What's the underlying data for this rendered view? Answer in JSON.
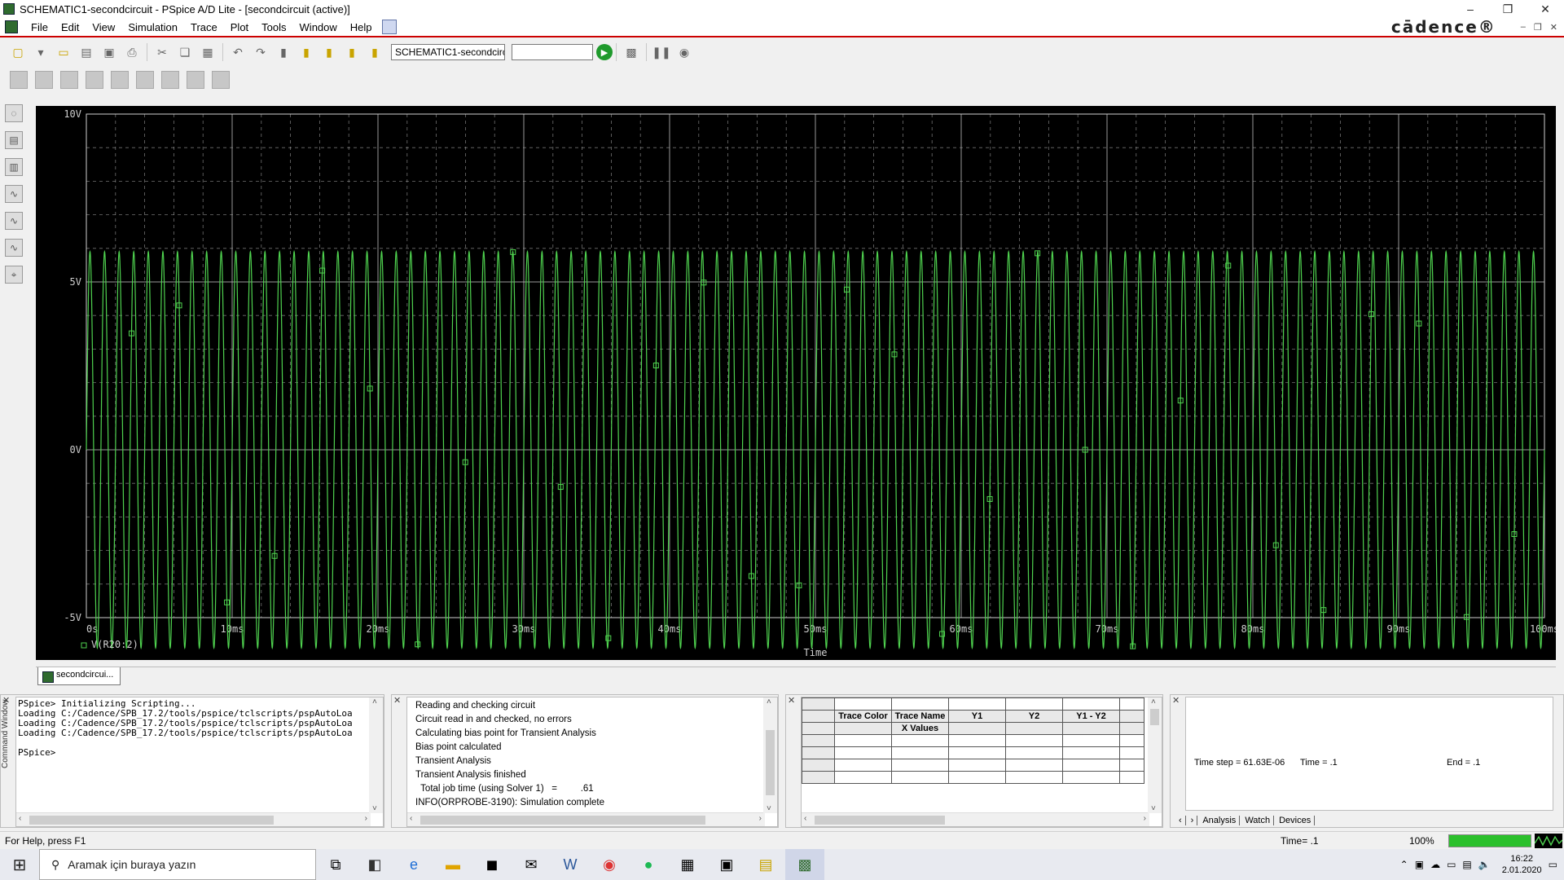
{
  "window": {
    "title": "SCHEMATIC1-secondcircuit - PSpice A/D Lite - [secondcircuit (active)]",
    "minimize": "–",
    "maximize": "❐",
    "close": "✕"
  },
  "menu": {
    "items": [
      "File",
      "Edit",
      "View",
      "Simulation",
      "Trace",
      "Plot",
      "Tools",
      "Window",
      "Help"
    ],
    "brand": "cādence®"
  },
  "toolbar": {
    "profile_value": "SCHEMATIC1-secondcircui",
    "run_icon": "play-icon"
  },
  "plot": {
    "background": "#000000",
    "trace_color": "#4fd24f",
    "grid_color": "#bdbdbd",
    "axis_color": "#cfcfcf",
    "y_tick_labels": [
      "10V",
      "5V",
      "0V",
      "-5V"
    ],
    "x_tick_labels": [
      "0s",
      "10ms",
      "20ms",
      "30ms",
      "40ms",
      "50ms",
      "60ms",
      "70ms",
      "80ms",
      "90ms",
      "100ms"
    ],
    "x_label": "Time",
    "legend": "V(R20:2)"
  },
  "chart_data": {
    "type": "line",
    "title": "",
    "xlabel": "Time",
    "ylabel": "",
    "x_unit": "ms",
    "y_unit": "V",
    "xlim": [
      0,
      100
    ],
    "ylim": [
      -5,
      10
    ],
    "grid": true,
    "legend_position": "bottom-left",
    "series": [
      {
        "name": "V(R20:2)",
        "waveform": "sine",
        "amplitude_V": 5.9,
        "offset_V": 0,
        "frequency_Hz": 1000,
        "t_start_ms": 0,
        "t_end_ms": 100
      }
    ]
  },
  "doc_tab": {
    "label": "secondcircui..."
  },
  "command_window": {
    "label": "Command Window",
    "lines": [
      "PSpice> Initializing Scripting...",
      "Loading C:/Cadence/SPB_17.2/tools/pspice/tclscripts/pspAutoLoa",
      "Loading C:/Cadence/SPB_17.2/tools/pspice/tclscripts/pspAutoLoa",
      "Loading C:/Cadence/SPB_17.2/tools/pspice/tclscripts/pspAutoLoa",
      "",
      "PSpice>"
    ]
  },
  "output_log": {
    "lines": [
      "Reading and checking circuit",
      "Circuit read in and checked, no errors",
      "Calculating bias point for Transient Analysis",
      "Bias point calculated",
      "Transient Analysis",
      "Transient Analysis finished",
      "  Total job time (using Solver 1)   =         .61",
      "INFO(ORPROBE-3190): Simulation complete"
    ]
  },
  "probe_table": {
    "headers": [
      "Trace Color",
      "Trace Name",
      "Y1",
      "Y2",
      "Y1 - Y2"
    ],
    "sub_header": "X Values"
  },
  "sim_status": {
    "time_step": "Time step =  61.63E-06",
    "time": "Time =  .1",
    "end": "End =  .1",
    "tabs": [
      "Analysis",
      "Watch",
      "Devices"
    ]
  },
  "status": {
    "help": "For Help, press F1",
    "time": "Time= .1",
    "zoom": "100%",
    "progress": 1.0
  },
  "taskbar": {
    "search_placeholder": "Aramak için buraya yazın",
    "time": "16:22",
    "date": "2.01.2020"
  }
}
